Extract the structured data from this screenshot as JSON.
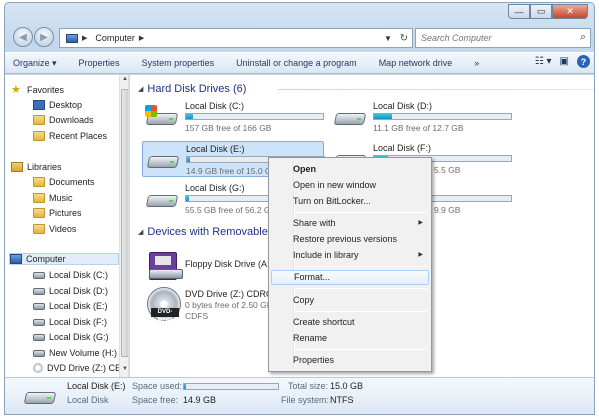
{
  "window": {
    "caption_buttons": [
      "—",
      "▭",
      "✕"
    ]
  },
  "address": {
    "crumb": "Computer",
    "search_placeholder": "Search Computer"
  },
  "toolbar": {
    "organize": "Organize ▾",
    "properties": "Properties",
    "system_properties": "System properties",
    "uninstall": "Uninstall or change a program",
    "map_network": "Map network drive",
    "more": "»"
  },
  "nav": {
    "favorites": "Favorites",
    "desktop": "Desktop",
    "downloads": "Downloads",
    "recent": "Recent Places",
    "libraries": "Libraries",
    "documents": "Documents",
    "music": "Music",
    "pictures": "Pictures",
    "videos": "Videos",
    "computer": "Computer",
    "drives": [
      "Local Disk (C:)",
      "Local Disk (D:)",
      "Local Disk (E:)",
      "Local Disk (F:)",
      "Local Disk (G:)",
      "New Volume (H:)",
      "DVD Drive (Z:) CE"
    ]
  },
  "content": {
    "hdd_header": "Hard Disk Drives (6)",
    "removable_header": "Devices with Removable",
    "drives": [
      {
        "name": "Local Disk (C:)",
        "free": "157 GB free of 166 GB",
        "used_fraction": 0.05
      },
      {
        "name": "Local Disk (D:)",
        "free": "11.1 GB free of 12.7 GB",
        "used_fraction": 0.13
      },
      {
        "name": "Local Disk (E:)",
        "free": "14.9 GB free of 15.0 GB",
        "used_fraction": 0.01
      },
      {
        "name": "Local Disk (F:)",
        "free": "5.5 GB",
        "used_fraction": 0.1
      },
      {
        "name": "Local Disk (G:)",
        "free": "55.5 GB free of 56.2 GB",
        "used_fraction": 0.01
      },
      {
        "name": "",
        "free": "9.9 GB",
        "used_fraction": 0.05
      }
    ],
    "floppy": {
      "name": "Floppy Disk Drive (A:)"
    },
    "dvd": {
      "name": "DVD Drive (Z:) CDRON",
      "free": "0 bytes free of 2.50 GB",
      "fs": "CDFS",
      "label": "DVD-ROM"
    }
  },
  "context_menu": {
    "open": "Open",
    "open_new": "Open in new window",
    "bitlocker": "Turn on BitLocker...",
    "share": "Share with",
    "restore": "Restore previous versions",
    "include": "Include in library",
    "format": "Format...",
    "copy": "Copy",
    "shortcut": "Create shortcut",
    "rename": "Rename",
    "properties": "Properties"
  },
  "details": {
    "name": "Local Disk (E:)",
    "type": "Local Disk",
    "space_used_label": "Space used:",
    "space_free_label": "Space free:",
    "space_free": "14.9 GB",
    "total_size_label": "Total size:",
    "total_size": "15.0 GB",
    "fs_label": "File system:",
    "fs": "NTFS",
    "used_fraction": 0.01
  }
}
